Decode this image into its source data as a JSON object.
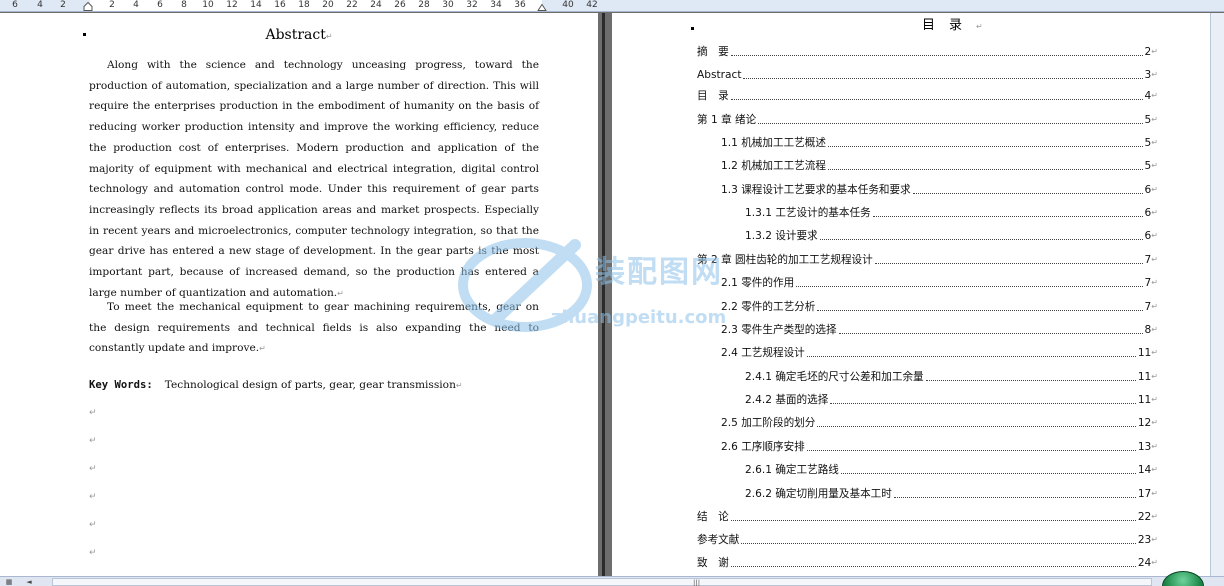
{
  "ruler": {
    "ticks": [
      "6",
      "4",
      "2",
      "2",
      "4",
      "6",
      "8",
      "10",
      "12",
      "14",
      "16",
      "18",
      "20",
      "22",
      "24",
      "26",
      "28",
      "30",
      "32",
      "34",
      "36",
      "40",
      "42"
    ]
  },
  "left_page": {
    "title": "Abstract",
    "para_mark": "↵",
    "paragraph1": "Along with the science and technology unceasing progress, toward the production of automation, specialization and a large number of direction. This will require the enterprises production in the embodiment of humanity on the basis of reducing worker production intensity and improve the working efficiency, reduce the production cost of enterprises. Modern production and application of the majority of equipment with mechanical and electrical integration, digital control technology and automation control mode. Under this requirement of gear parts increasingly reflects its broad application areas and market prospects. Especially in recent years and microelectronics, computer technology integration, so that the gear drive has entered a new stage of development. In the gear parts is the most important part, because of increased demand, so the production has entered a large number of quantization and automation.",
    "paragraph2": "To meet the mechanical equipment to gear machining requirements, gear on the design requirements and technical fields is also expanding the need to constantly update and improve.",
    "keywords_label": "Key Words:",
    "keywords_text": "Technological design of parts, gear, gear transmission"
  },
  "toc": {
    "title": "目录",
    "entries": [
      {
        "text": "摘　要",
        "page": "2"
      },
      {
        "text": "Abstract",
        "page": "3"
      },
      {
        "text": "目　录",
        "page": "4"
      },
      {
        "text": "第 1 章  绪论",
        "page": "5"
      },
      {
        "text": "1.1  机械加工工艺概述",
        "page": "5"
      },
      {
        "text": "1.2 机械加工工艺流程",
        "page": "5"
      },
      {
        "text": "1.3 课程设计工艺要求的基本任务和要求",
        "page": "6"
      },
      {
        "text": "1.3.1 工艺设计的基本任务",
        "page": "6"
      },
      {
        "text": "1.3.2 设计要求",
        "page": "6"
      },
      {
        "text": "第 2 章  圆柱齿轮的加工工艺规程设计",
        "page": "7"
      },
      {
        "text": "2.1  零件的作用",
        "page": "7"
      },
      {
        "text": "2.2 零件的工艺分析",
        "page": "7"
      },
      {
        "text": "2.3 零件生产类型的选择",
        "page": "8"
      },
      {
        "text": "2.4 工艺规程设计",
        "page": "11"
      },
      {
        "text": "2.4.1  确定毛坯的尺寸公差和加工余量",
        "page": "11"
      },
      {
        "text": "2.4.2 基面的选择",
        "page": "11"
      },
      {
        "text": "2.5 加工阶段的划分",
        "page": "12"
      },
      {
        "text": "2.6 工序顺序安排",
        "page": "13"
      },
      {
        "text": "2.6.1  确定工艺路线",
        "page": "14"
      },
      {
        "text": "2.6.2 确定切削用量及基本工时",
        "page": "17"
      },
      {
        "text": "结　论",
        "page": "22"
      },
      {
        "text": "参考文献",
        "page": "23"
      },
      {
        "text": "致　谢",
        "page": "24"
      }
    ]
  },
  "watermark": {
    "cn": "装配图网",
    "en": "zhuangpeitu.com"
  },
  "status": {
    "grip": "|||"
  }
}
